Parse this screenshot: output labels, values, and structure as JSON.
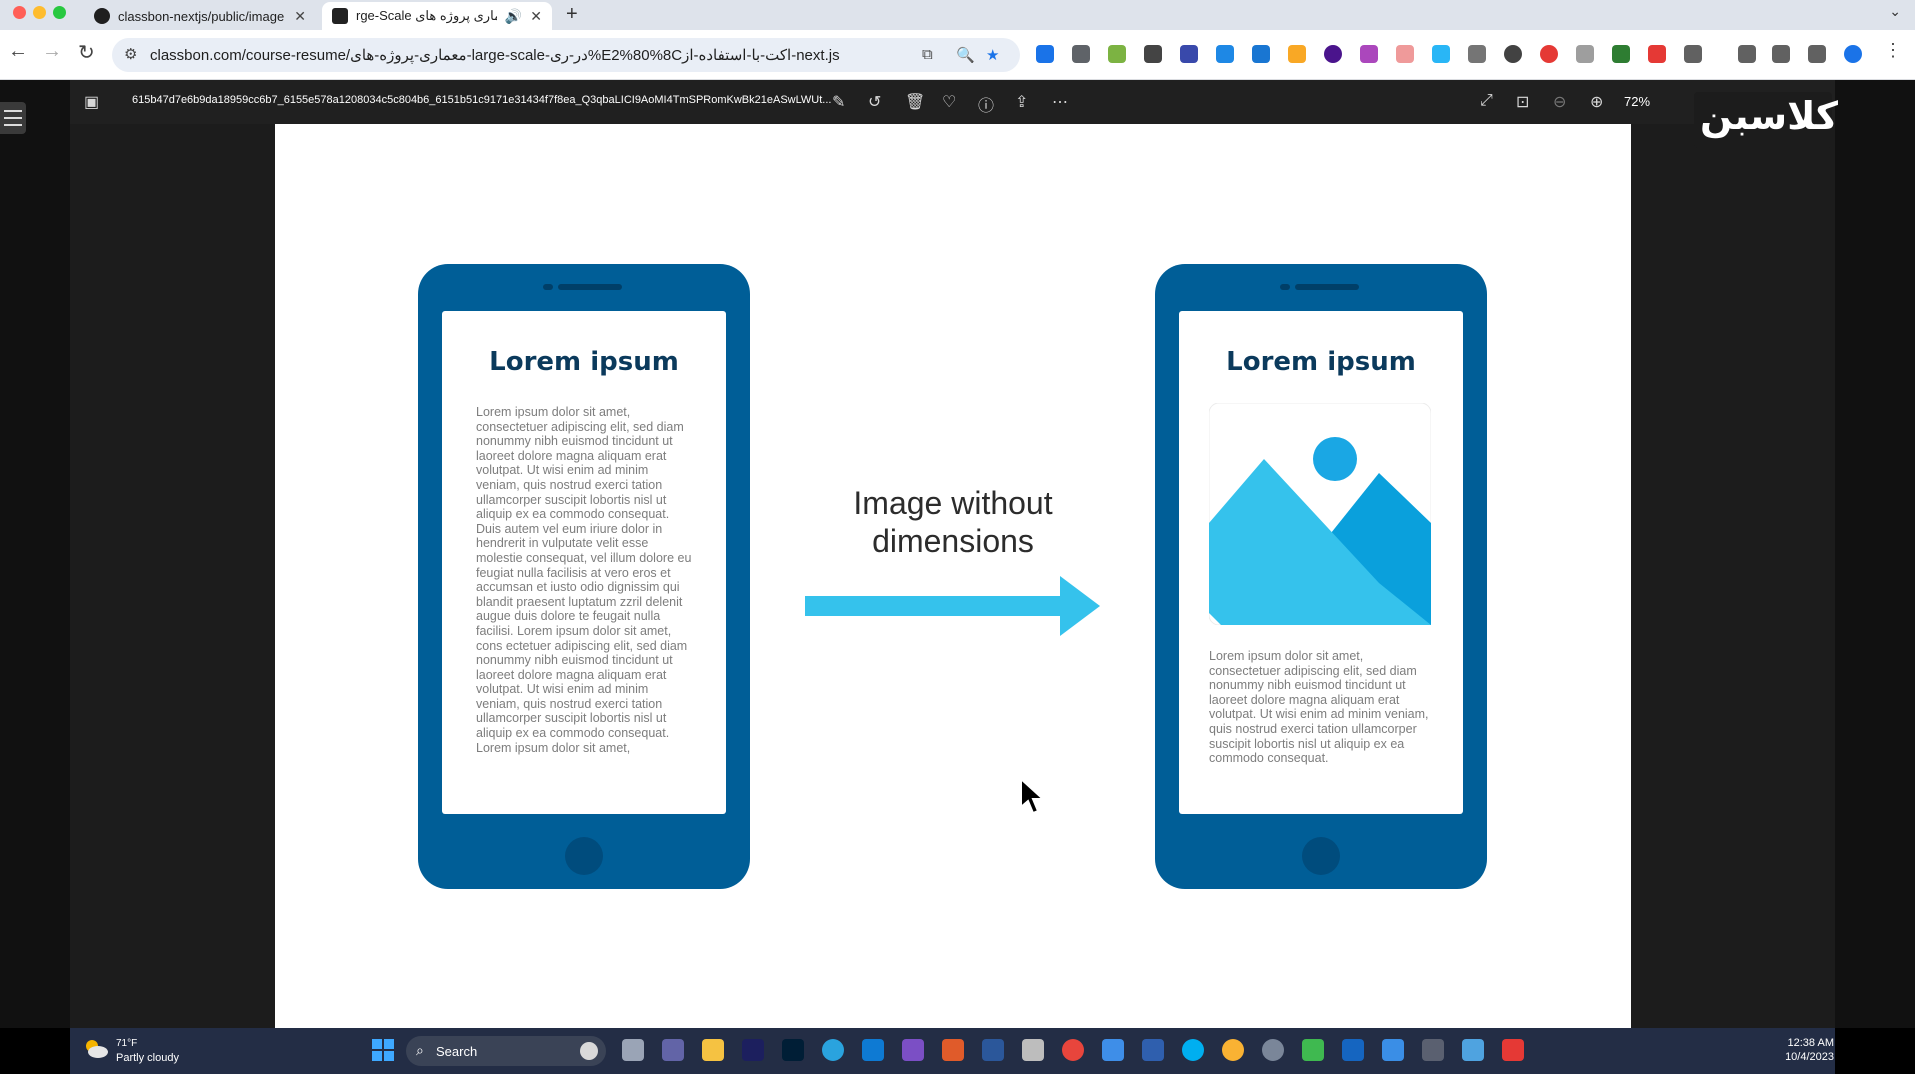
{
  "browser": {
    "tabs": [
      {
        "title": "classbon-nextjs/public/image",
        "favicon": "github-icon"
      },
      {
        "title": "rge-Scale معماری پروژه های",
        "favicon": "classbon-icon"
      }
    ],
    "new_tab_label": "+",
    "address": "classbon.com/course-resume/معماری-پروژه-های-large-scale-در-ری%E2%80%8Cاکت-با-استفاده-از-next.js"
  },
  "viewer": {
    "filename": "615b47d7e6b9da18959cc6b7_6155e578a1208034c5c804b6_6151b51c9171e31434f7f8ea_Q3qbaLICI9AoMI4TmSPRomKwBk21eASwLWUt...",
    "zoom": "72%",
    "logo_text": "کلاسبن"
  },
  "slide": {
    "left_phone": {
      "title": "Lorem ipsum",
      "body": "Lorem ipsum dolor sit amet, consectetuer adipiscing elit, sed diam nonummy nibh euismod tincidunt ut laoreet dolore magna aliquam erat volutpat. Ut wisi enim ad minim veniam, quis nostrud exerci tation ullamcorper suscipit lobortis nisl ut aliquip ex ea commodo consequat. Duis autem vel eum iriure dolor in hendrerit in vulputate velit esse molestie consequat, vel illum dolore eu feugiat nulla facilisis at vero eros et accumsan et iusto odio dignissim qui blandit praesent luptatum zzril delenit augue duis dolore te feugait nulla facilisi. Lorem ipsum dolor sit amet, cons ectetuer adipiscing elit, sed diam nonummy nibh euismod tincidunt ut laoreet dolore magna aliquam erat volutpat. Ut wisi enim ad minim veniam, quis nostrud exerci tation ullamcorper suscipit lobortis nisl ut aliquip ex ea commodo consequat. Lorem ipsum dolor sit amet,"
    },
    "caption": "Image without dimensions",
    "right_phone": {
      "title": "Lorem ipsum",
      "body": "Lorem ipsum dolor sit amet, consectetuer adipiscing elit, sed diam nonummy nibh euismod tincidunt ut laoreet dolore magna aliquam erat volutpat. Ut wisi enim ad minim veniam, quis nostrud exerci tation ullamcorper suscipit lobortis nisl ut aliquip ex ea commodo consequat."
    },
    "colors": {
      "phone": "#005e97",
      "accent": "#35c2ec",
      "dark_accent": "#0aa0dc"
    }
  },
  "taskbar": {
    "weather_temp": "71°F",
    "weather_desc": "Partly cloudy",
    "search_label": "Search",
    "time": "12:38 AM",
    "date": "10/4/2023",
    "apps": [
      "file-explorer-icon",
      "teams-icon",
      "folder-icon",
      "audition-icon",
      "photoshop-icon",
      "telegram-icon",
      "vscode-icon",
      "visual-studio-icon",
      "onenote-icon",
      "word-icon",
      "database-icon",
      "chrome-icon",
      "tool-icon",
      "onenote-badge-icon",
      "skype-icon",
      "chrome-canary-icon",
      "settings-icon",
      "camtasia-icon",
      "remote-desktop-icon",
      "photos-icon",
      "terminal-icon",
      "notepad-icon",
      "camtasia-recorder-icon"
    ]
  }
}
